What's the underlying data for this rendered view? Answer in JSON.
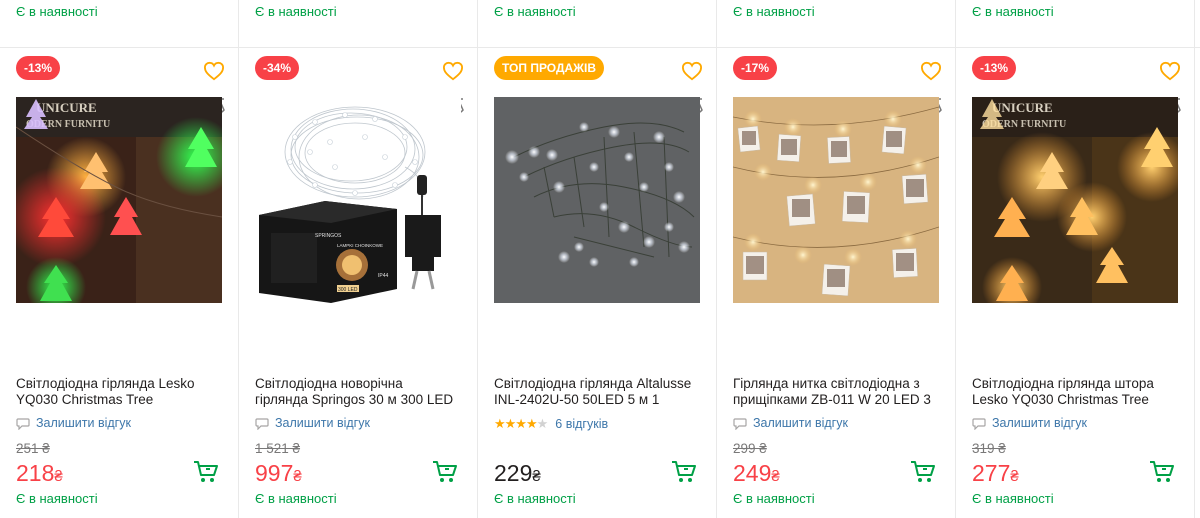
{
  "stock_label": "Є в наявності",
  "top_row": [
    "Є в наявності",
    "Є в наявності",
    "Є в наявності",
    "Є в наявності",
    "Є в наявності"
  ],
  "colors": {
    "green": "#00a046",
    "red": "#f84147",
    "orange": "#ffa900",
    "link": "#3e77aa"
  },
  "products": [
    {
      "badge": "-13%",
      "badge_type": "discount",
      "title": "Світлодіодна гірлянда Lesko YQ030 Christmas Tree",
      "review_label": "Залишити відгук",
      "old_price": "251 ₴",
      "price": "218",
      "currency": "₴",
      "stock": "Є в наявності",
      "image": "colorful-christmas-tree-garland"
    },
    {
      "badge": "-34%",
      "badge_type": "discount",
      "title": "Світлодіодна новорічна гірлянда Springos 30 м 300 LED",
      "review_label": "Залишити відгук",
      "old_price": "1 521 ₴",
      "price": "997",
      "currency": "₴",
      "stock": "Є в наявності",
      "image": "wire-garland-with-box",
      "box_text": {
        "brand": "SPRINGOS",
        "name": "LAMPKI CHOINKOWE",
        "leds": "300 LED",
        "ip": "IP44"
      }
    },
    {
      "badge": "ТОП ПРОДАЖІВ",
      "badge_type": "top",
      "title": "Світлодіодна гірлянда Altalusse INL-2402U-50 50LED 5 м 1",
      "rating": 4.5,
      "reviews_label": "6 відгуків",
      "old_price": "",
      "price": "229",
      "currency": "₴",
      "stock": "Є в наявності",
      "image": "white-led-string-on-gray"
    },
    {
      "badge": "-17%",
      "badge_type": "discount",
      "title": "Гірлянда нитка світлодіодна з прищіпками ZB-011 W 20 LED 3",
      "review_label": "Залишити відгук",
      "old_price": "299 ₴",
      "price": "249",
      "currency": "₴",
      "stock": "Є в наявності",
      "image": "photo-clip-garland"
    },
    {
      "badge": "-13%",
      "badge_type": "discount",
      "title": "Світлодіодна гірлянда штора Lesko YQ030 Christmas Tree",
      "review_label": "Залишити відгук",
      "old_price": "319 ₴",
      "price": "277",
      "currency": "₴",
      "stock": "Є в наявності",
      "image": "warm-christmas-tree-garland"
    }
  ]
}
